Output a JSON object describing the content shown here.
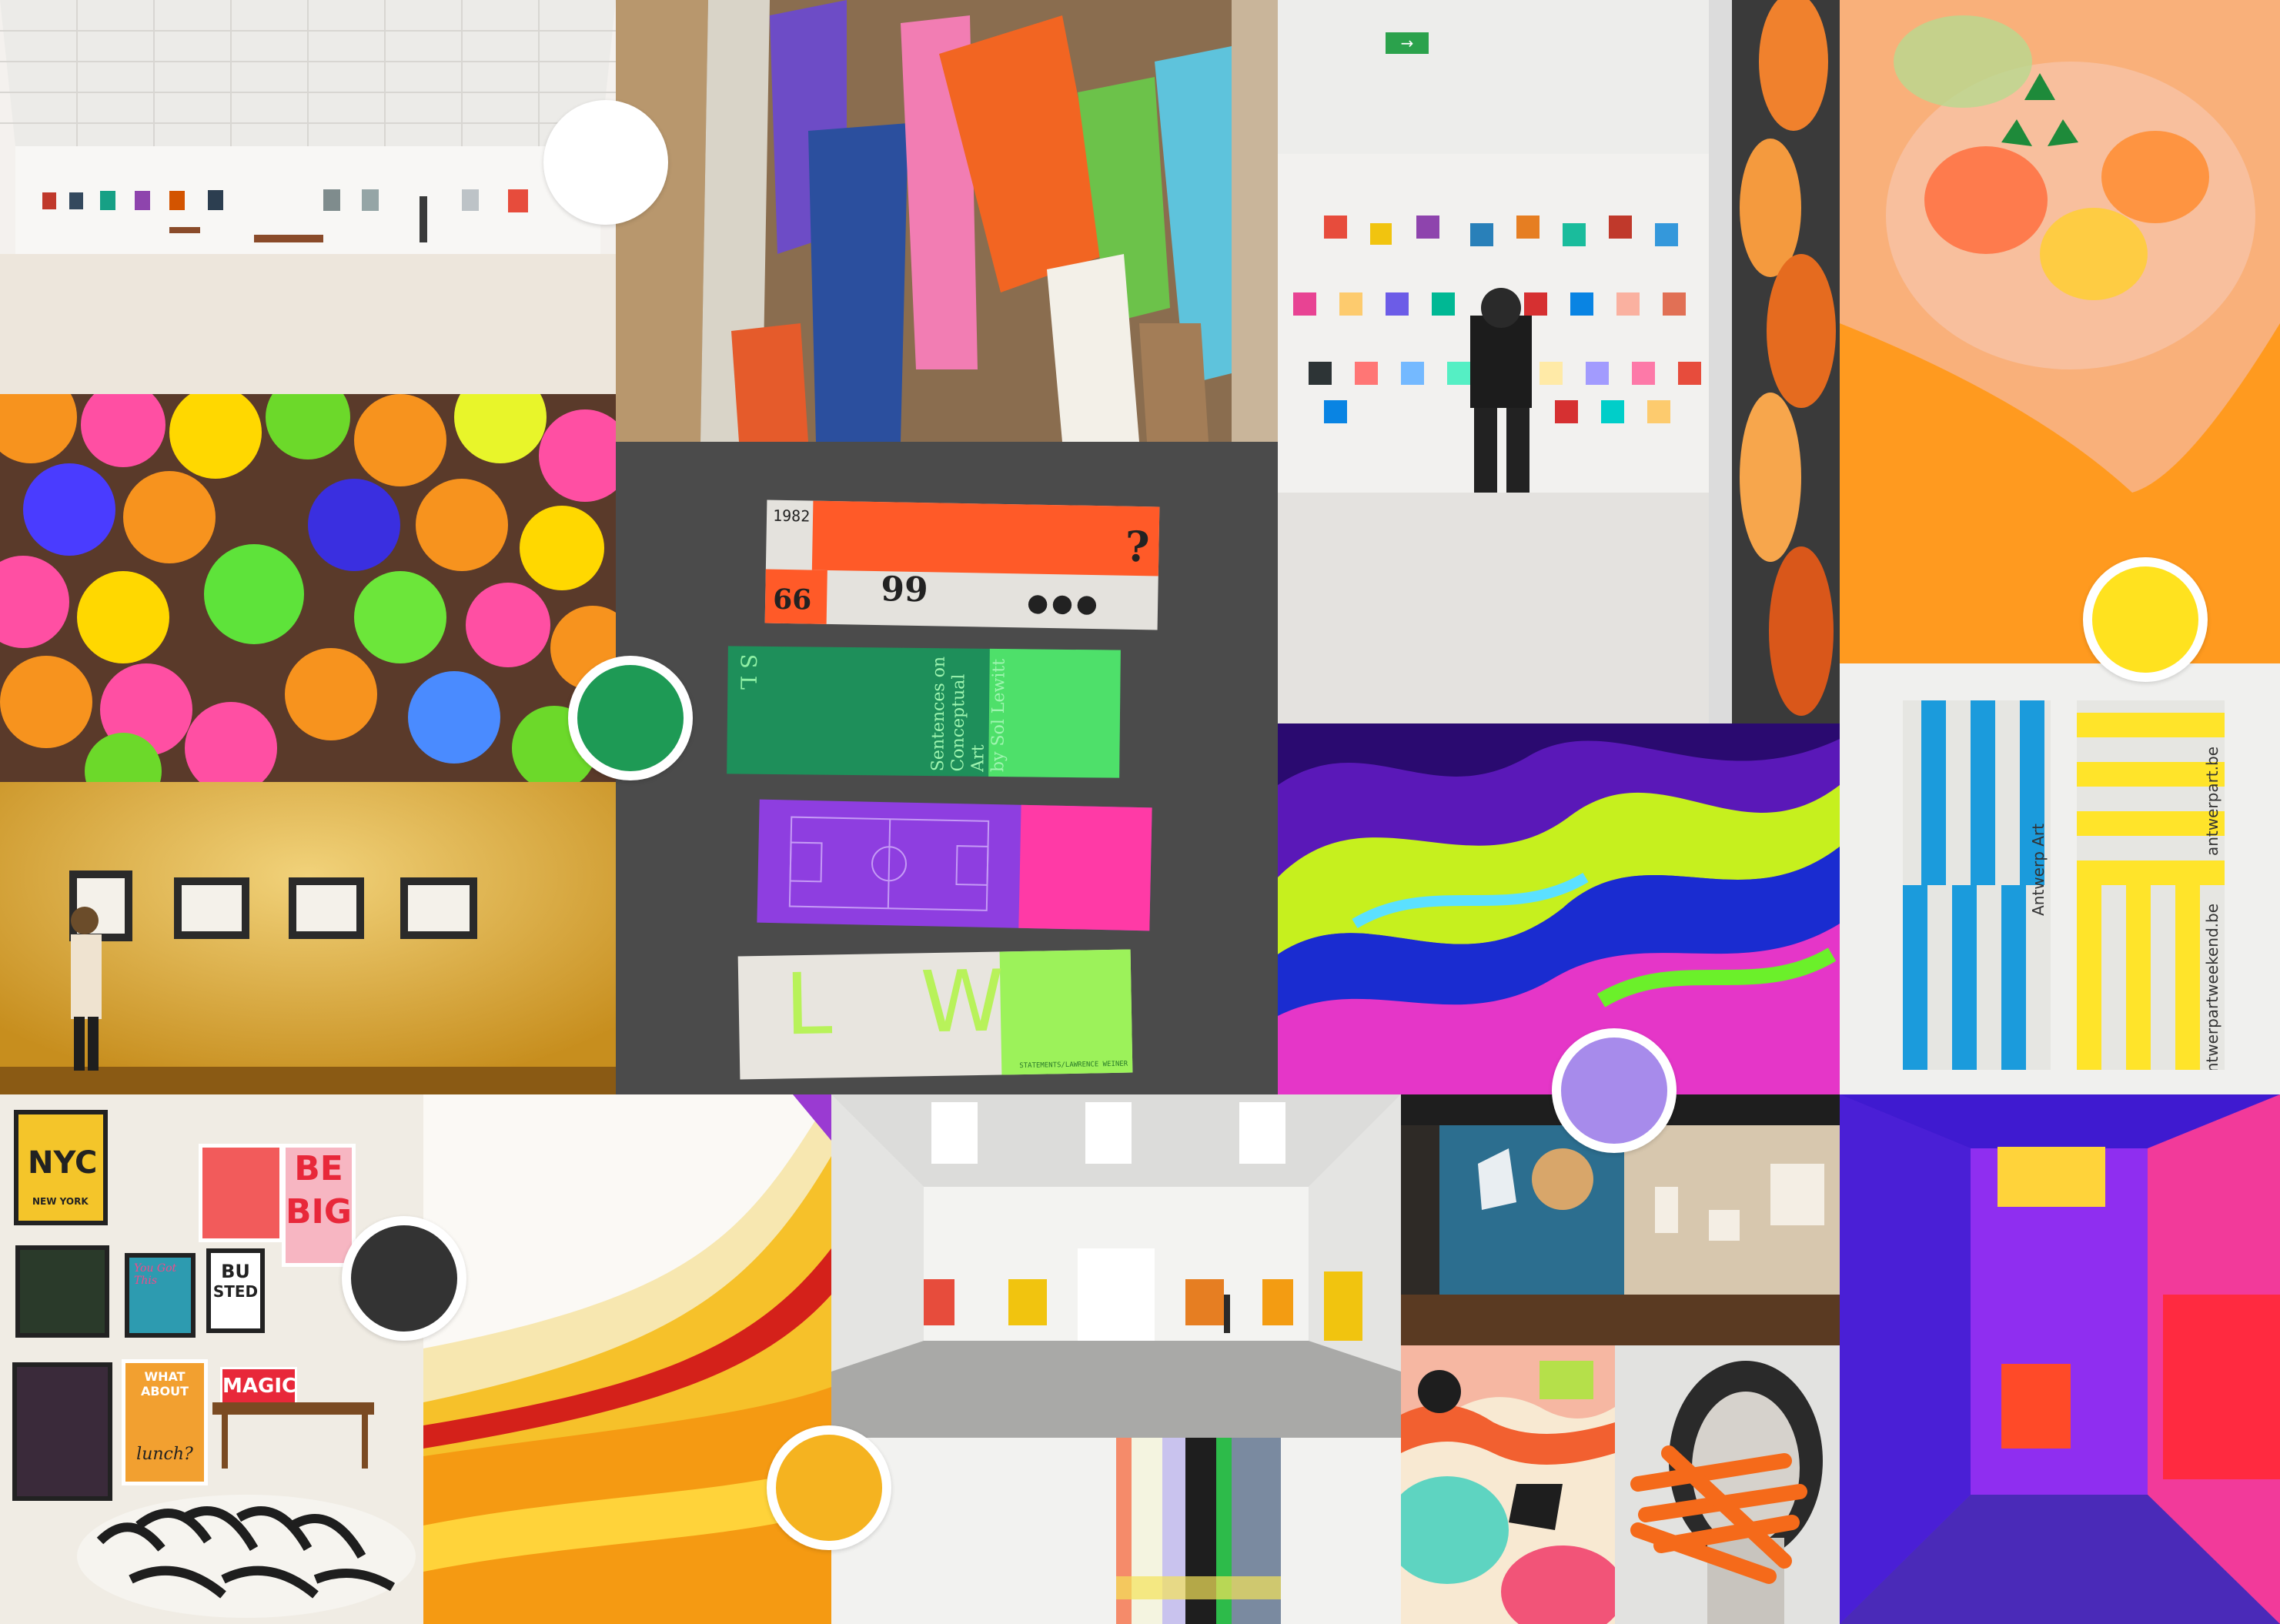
{
  "palette": [
    {
      "name": "white",
      "color": "#FFFFFF"
    },
    {
      "name": "green",
      "color": "#1E9A55"
    },
    {
      "name": "yellow",
      "color": "#FFE21F"
    },
    {
      "name": "lavender",
      "color": "#A78BEB"
    },
    {
      "name": "charcoal",
      "color": "#333333"
    },
    {
      "name": "amber",
      "color": "#F5B320"
    }
  ],
  "ticket_1": {
    "year": "1982",
    "question": "?",
    "open_quote": "66",
    "close_quote": "99",
    "dots": "●●●"
  },
  "ticket_2": {
    "title_line1": "Sentences on",
    "title_line2": "Conceptual Art",
    "title_line3": "by Sol Lewitt",
    "side": "S L"
  },
  "ticket_4": {
    "letters": "L W",
    "footer": "STATEMENTS/LAWRENCE WEINER"
  },
  "antwerp": {
    "left_label": "Antwerp Art",
    "right_label1": "antwerpart.be",
    "right_label2": "antwerpartweekend.be"
  },
  "poster_wall": {
    "nyc": "NYC",
    "new_york": "NEW YORK",
    "be": "BE",
    "big": "BIG",
    "magic": "MAGIC",
    "what_about": "WHAT ABOUT",
    "lunch": "lunch?",
    "you_got": "You Got This",
    "busted_1": "BU",
    "busted_2": "STED"
  },
  "exit_sign": "→"
}
